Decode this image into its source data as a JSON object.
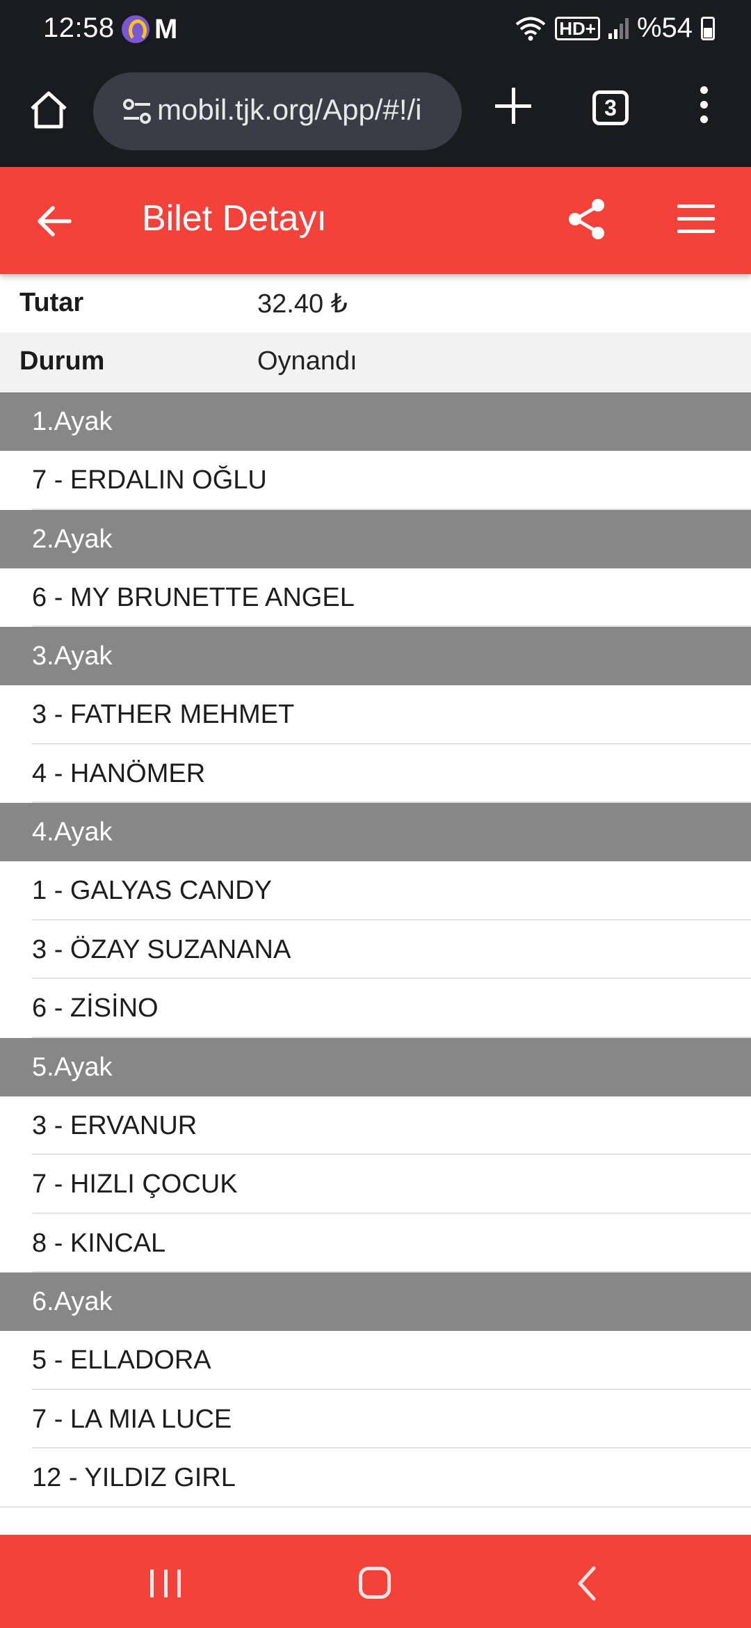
{
  "status_bar": {
    "time": "12:58",
    "app_badge": "M",
    "network": "HD+",
    "battery": "%54"
  },
  "browser": {
    "url": "mobil.tjk.org/App/#!/i",
    "tab_count": "3"
  },
  "header": {
    "title": "Bilet Detayı",
    "color": "#f4423a"
  },
  "info": [
    {
      "label": "Tutar",
      "value": "32.40 ₺"
    },
    {
      "label": "Durum",
      "value": "Oynandı"
    }
  ],
  "legs": [
    {
      "title": "1.Ayak",
      "horses": [
        "7 - ERDALIN OĞLU"
      ]
    },
    {
      "title": "2.Ayak",
      "horses": [
        "6 - MY BRUNETTE ANGEL"
      ]
    },
    {
      "title": "3.Ayak",
      "horses": [
        "3 - FATHER MEHMET",
        "4 - HANÖMER"
      ]
    },
    {
      "title": "4.Ayak",
      "horses": [
        "1 - GALYAS CANDY",
        "3 - ÖZAY SUZANANA",
        "6 - ZİSİNO"
      ]
    },
    {
      "title": "5.Ayak",
      "horses": [
        "3 - ERVANUR",
        "7 - HIZLI ÇOCUK",
        "8 - KINCAL"
      ]
    },
    {
      "title": "6.Ayak",
      "horses": [
        "5 - ELLADORA",
        "7 - LA MIA LUCE",
        "12 - YILDIZ GIRL"
      ]
    }
  ]
}
